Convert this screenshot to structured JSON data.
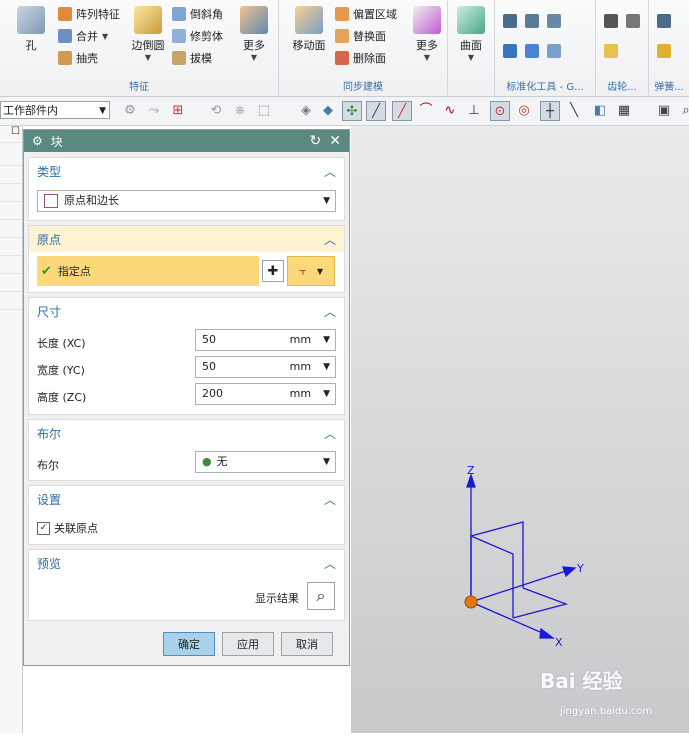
{
  "ribbon": {
    "features": {
      "hole": "孔",
      "pattern": "阵列特征",
      "unite": "合并",
      "shell": "抽壳",
      "edge_blend": "边倒圆",
      "chamfer": "倒斜角",
      "trim_body": "修剪体",
      "draft": "拔模",
      "more": "更多",
      "group_label": "特征"
    },
    "sync": {
      "move_face": "移动面",
      "offset_region": "偏置区域",
      "replace_face": "替换面",
      "delete_face": "删除面",
      "more": "更多",
      "group_label": "同步建模"
    },
    "surface": {
      "label": "曲面"
    },
    "std_tools": {
      "group_label": "标准化工具 - G..."
    },
    "gear": {
      "group_label": "齿轮..."
    },
    "spring": {
      "group_label": "弹簧..."
    }
  },
  "toolbar": {
    "filter_value": "工作部件内"
  },
  "dialog": {
    "title": "块",
    "type": {
      "header": "类型",
      "value": "原点和边长"
    },
    "origin": {
      "header": "原点",
      "specify_point": "指定点"
    },
    "dimensions": {
      "header": "尺寸",
      "rows": [
        {
          "label": "长度 (XC)",
          "value": "50",
          "unit": "mm"
        },
        {
          "label": "宽度 (YC)",
          "value": "50",
          "unit": "mm"
        },
        {
          "label": "高度 (ZC)",
          "value": "200",
          "unit": "mm"
        }
      ]
    },
    "boolean": {
      "header": "布尔",
      "label": "布尔",
      "value": "无"
    },
    "settings": {
      "header": "设置",
      "assoc_origin": "关联原点",
      "assoc_checked": true
    },
    "preview": {
      "header": "预览",
      "show_result": "显示结果"
    },
    "buttons": {
      "ok": "确定",
      "apply": "应用",
      "cancel": "取消"
    }
  },
  "viewport": {
    "axes": {
      "x": "X",
      "y": "Y",
      "z": "Z"
    },
    "watermark": "Bai 经验",
    "watermark_url": "jingyan.baidu.com"
  },
  "colors": {
    "title_bar": "#5a8a7f",
    "highlight": "#fbdb7a",
    "axis": "#1010d0",
    "origin": "#e07a10"
  }
}
